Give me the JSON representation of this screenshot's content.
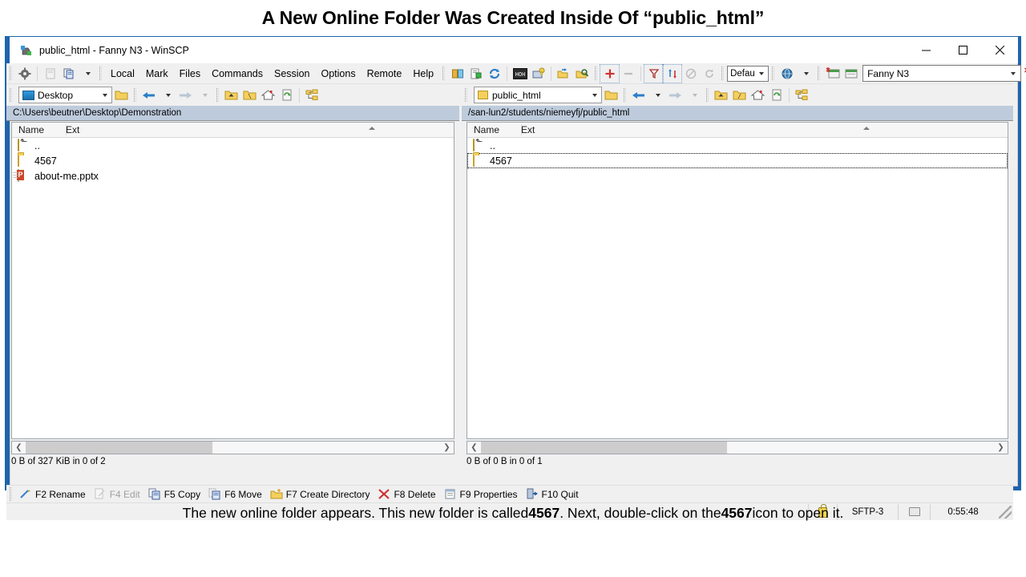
{
  "slide": {
    "title": "A New Online Folder Was Created Inside Of “public_html”",
    "caption_part1": "The new online folder appears. This new folder is called ",
    "caption_bold1": "4567",
    "caption_part2": ". Next, double-click on the ",
    "caption_bold2": "4567",
    "caption_part3": " icon to open it."
  },
  "window": {
    "title": "public_html - Fanny N3 - WinSCP",
    "icon": "winscp-app-icon",
    "minimize_label": "—",
    "maximize_label": "☐",
    "close_label": "✕"
  },
  "menu": {
    "items": [
      {
        "label": "Local",
        "name": "menu-local"
      },
      {
        "label": "Mark",
        "name": "menu-mark"
      },
      {
        "label": "Files",
        "name": "menu-files"
      },
      {
        "label": "Commands",
        "name": "menu-commands"
      },
      {
        "label": "Session",
        "name": "menu-session"
      },
      {
        "label": "Options",
        "name": "menu-options"
      },
      {
        "label": "Remote",
        "name": "menu-remote"
      },
      {
        "label": "Help",
        "name": "menu-help"
      }
    ]
  },
  "toolbar": {
    "transfer_preset": "Defau",
    "session_name": "Fanny N3",
    "icons": [
      "gear-icon",
      "clipboard-disabled-icon",
      "copy-files-icon",
      "split-view-icon",
      "properties-icon",
      "refresh-icon",
      "console-icon",
      "keys-icon",
      "synchronize-icon",
      "search-icon",
      "add-bookmark-icon",
      "remove-bookmark-icon",
      "filter-icon",
      "sync-browsing-icon",
      "stop-icon",
      "reload-icon",
      "globe-icon",
      "new-session-icon",
      "sessions-list-icon",
      "close-session-icon",
      "open-session-icon",
      "save-session-icon"
    ]
  },
  "left_panel": {
    "name": "local-panel",
    "dir_combo": "Desktop",
    "dir_combo_icon": "desktop-icon",
    "path": "C:\\Users\\beutner\\Desktop\\Demonstration",
    "columns": [
      "Name",
      "Ext"
    ],
    "rows": [
      {
        "name": "..",
        "ext": "",
        "icon": "parent-folder-icon",
        "focused": false
      },
      {
        "name": "4567",
        "ext": "",
        "icon": "folder-icon",
        "focused": false
      },
      {
        "name": "about-me.pptx",
        "ext": "",
        "icon": "powerpoint-file-icon",
        "focused": false
      }
    ],
    "status": "0 B of 327 KiB in 0 of 2",
    "scroll_thumb_pct": 45
  },
  "right_panel": {
    "name": "remote-panel",
    "dir_combo": "public_html",
    "dir_combo_icon": "folder-icon",
    "path": "/san-lun2/students/niemeyfj/public_html",
    "columns": [
      "Name",
      "Ext"
    ],
    "rows": [
      {
        "name": "..",
        "ext": "",
        "icon": "parent-folder-icon",
        "focused": false
      },
      {
        "name": "4567",
        "ext": "",
        "icon": "folder-icon",
        "focused": true
      }
    ],
    "status": "0 B of 0 B in 0 of 1",
    "scroll_thumb_pct": 48
  },
  "function_keys": [
    {
      "label": "F2 Rename",
      "icon": "rename-icon",
      "disabled": false
    },
    {
      "label": "F4 Edit",
      "icon": "edit-icon",
      "disabled": true
    },
    {
      "label": "F5 Copy",
      "icon": "copy-icon",
      "disabled": false
    },
    {
      "label": "F6 Move",
      "icon": "move-icon",
      "disabled": false
    },
    {
      "label": "F7 Create Directory",
      "icon": "new-folder-icon",
      "disabled": false
    },
    {
      "label": "F8 Delete",
      "icon": "delete-icon",
      "disabled": false
    },
    {
      "label": "F9 Properties",
      "icon": "properties-icon",
      "disabled": false
    },
    {
      "label": "F10 Quit",
      "icon": "quit-icon",
      "disabled": false
    }
  ],
  "statusbar": {
    "lock_icon": "lock-icon",
    "protocol": "SFTP-3",
    "monitor_icon": "remote-monitor-icon",
    "duration": "0:55:48"
  },
  "colors": {
    "window_frame": "#1e64ad",
    "path_bar": "#bdcbdc",
    "toolbar_bg": "#f0f0f0",
    "folder_yellow": "#f5cf5e"
  }
}
